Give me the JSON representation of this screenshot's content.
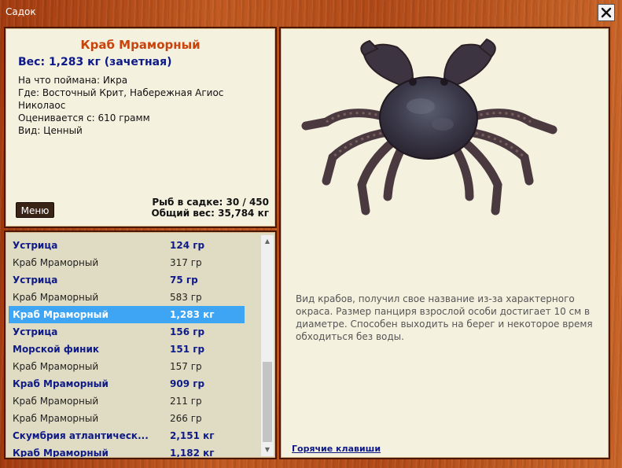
{
  "window": {
    "title": "Садок",
    "close_label": "✕"
  },
  "info": {
    "name": "Краб Мраморный",
    "weight": "Вес: 1,283 кг (зачетная)",
    "caught_on": "На что поймана: Икра",
    "location": "Где: Восточный Крит, Набережная Агиос Николаос",
    "valued_from": "Оценивается с: 610 грамм",
    "kind": "Вид: Ценный",
    "fish_in_keepnet": "Рыб в садке: 30 / 450",
    "total_weight": "Общий вес: 35,784 кг",
    "menu_button": "Меню"
  },
  "detail": {
    "image_icon": "marble-crab-image",
    "description": "Вид крабов, получил свое название из-за характерного окраса. Размер панциря взрослой особи достигает 10 см в диаметре. Способен выходить на берег и некоторое время обходиться без воды.",
    "hotkeys_link": "Горячие клавиши"
  },
  "catch_list": [
    {
      "name": "Устрица",
      "weight": "124 гр",
      "style": "bold"
    },
    {
      "name": "Краб Мраморный",
      "weight": "317 гр",
      "style": "plain"
    },
    {
      "name": "Устрица",
      "weight": "75 гр",
      "style": "bold"
    },
    {
      "name": "Краб Мраморный",
      "weight": "583 гр",
      "style": "plain"
    },
    {
      "name": "Краб Мраморный",
      "weight": "1,283 кг",
      "style": "sel"
    },
    {
      "name": "Устрица",
      "weight": "156 гр",
      "style": "bold"
    },
    {
      "name": "Морской финик",
      "weight": "151 гр",
      "style": "bold"
    },
    {
      "name": "Краб Мраморный",
      "weight": "157 гр",
      "style": "plain"
    },
    {
      "name": "Краб Мраморный",
      "weight": "909 гр",
      "style": "bold"
    },
    {
      "name": "Краб Мраморный",
      "weight": "211 гр",
      "style": "plain"
    },
    {
      "name": "Краб Мраморный",
      "weight": "266 гр",
      "style": "plain"
    },
    {
      "name": "Скумбрия атлантическ...",
      "weight": "2,151 кг",
      "style": "bold"
    },
    {
      "name": "Краб Мраморный",
      "weight": "1,182 кг",
      "style": "bold"
    }
  ],
  "colors": {
    "wood": "#b24a18",
    "panel": "#f5f1df",
    "list_bg": "#e0dcc3",
    "accent_name": "#c8440c",
    "navy": "#0e1a88",
    "selection": "#3ea4f4"
  }
}
